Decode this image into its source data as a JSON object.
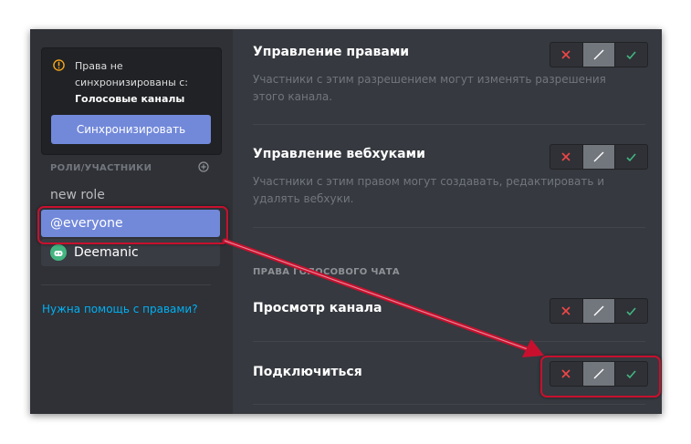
{
  "sidebar": {
    "sync_notice": "Права не синхронизированы с:",
    "sync_channel": "Голосовые каналы",
    "sync_button": "Синхронизировать",
    "roles_header": "РОЛИ/УЧАСТНИКИ",
    "roles": [
      "new role",
      "@everyone"
    ],
    "member": "Deemanic",
    "help_link": "Нужна помощь с правами?"
  },
  "permissions": {
    "manage_permissions": {
      "title": "Управление правами",
      "desc": "Участники с этим разрешением могут изменять разрешения этого канала."
    },
    "manage_webhooks": {
      "title": "Управление вебхуками",
      "desc": "Участники с этим правом могут создавать, редактировать и удалять вебхуки."
    },
    "voice_section": "ПРАВА ГОЛОСОВОГО ЧАТА",
    "view_channel": {
      "title": "Просмотр канала"
    },
    "connect": {
      "title": "Подключиться"
    }
  },
  "colors": {
    "deny": "#f04747",
    "neutral": "#72767d",
    "allow": "#43b581",
    "highlight": "#c8102e",
    "accent": "#7289da",
    "link": "#00b0f4"
  },
  "icons": [
    "warning-icon",
    "plus-circle-icon",
    "discord-icon",
    "cross-icon",
    "slash-icon",
    "check-icon"
  ]
}
